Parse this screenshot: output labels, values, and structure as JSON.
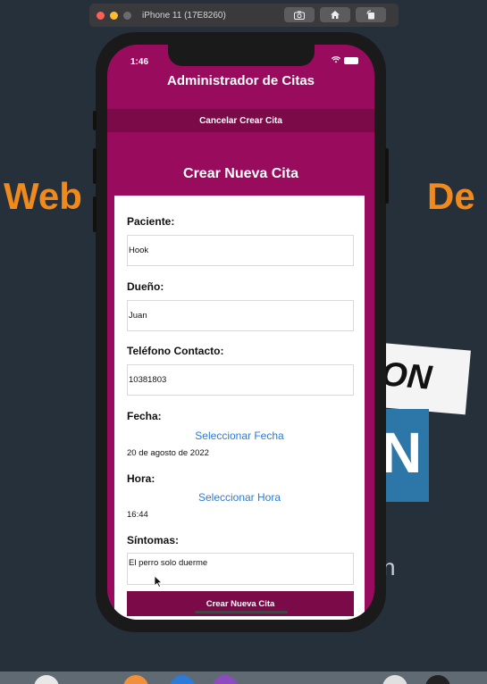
{
  "simulator": {
    "title": "iPhone 11 (17E8260)",
    "buttons": [
      "camera-icon",
      "home-icon",
      "rotate-icon"
    ]
  },
  "background": {
    "left_word": "Web",
    "right_word": "De",
    "card_text": "ON",
    "card_letter": "N",
    "small_letter": "n"
  },
  "status_bar": {
    "time": "1:46"
  },
  "app": {
    "title": "Administrador de Citas",
    "cancel_label": "Cancelar Crear Cita",
    "section_title": "Crear Nueva Cita"
  },
  "form": {
    "paciente_label": "Paciente:",
    "paciente_value": "Hook",
    "dueno_label": "Dueño:",
    "dueno_value": "Juan",
    "telefono_label": "Teléfono Contacto:",
    "telefono_value": "10381803",
    "fecha_label": "Fecha:",
    "fecha_link": "Seleccionar Fecha",
    "fecha_value": "20 de agosto de 2022",
    "hora_label": "Hora:",
    "hora_link": "Seleccionar Hora",
    "hora_value": "16:44",
    "sintomas_label": "Síntomas:",
    "sintomas_value": "El perro solo duerme",
    "submit_label": "Crear Nueva Cita"
  },
  "colors": {
    "primary": "#990b5c",
    "primary_dark": "#7a0a48",
    "link": "#2b7bd6",
    "background": "#25303b",
    "accent_orange": "#f08a1c"
  }
}
